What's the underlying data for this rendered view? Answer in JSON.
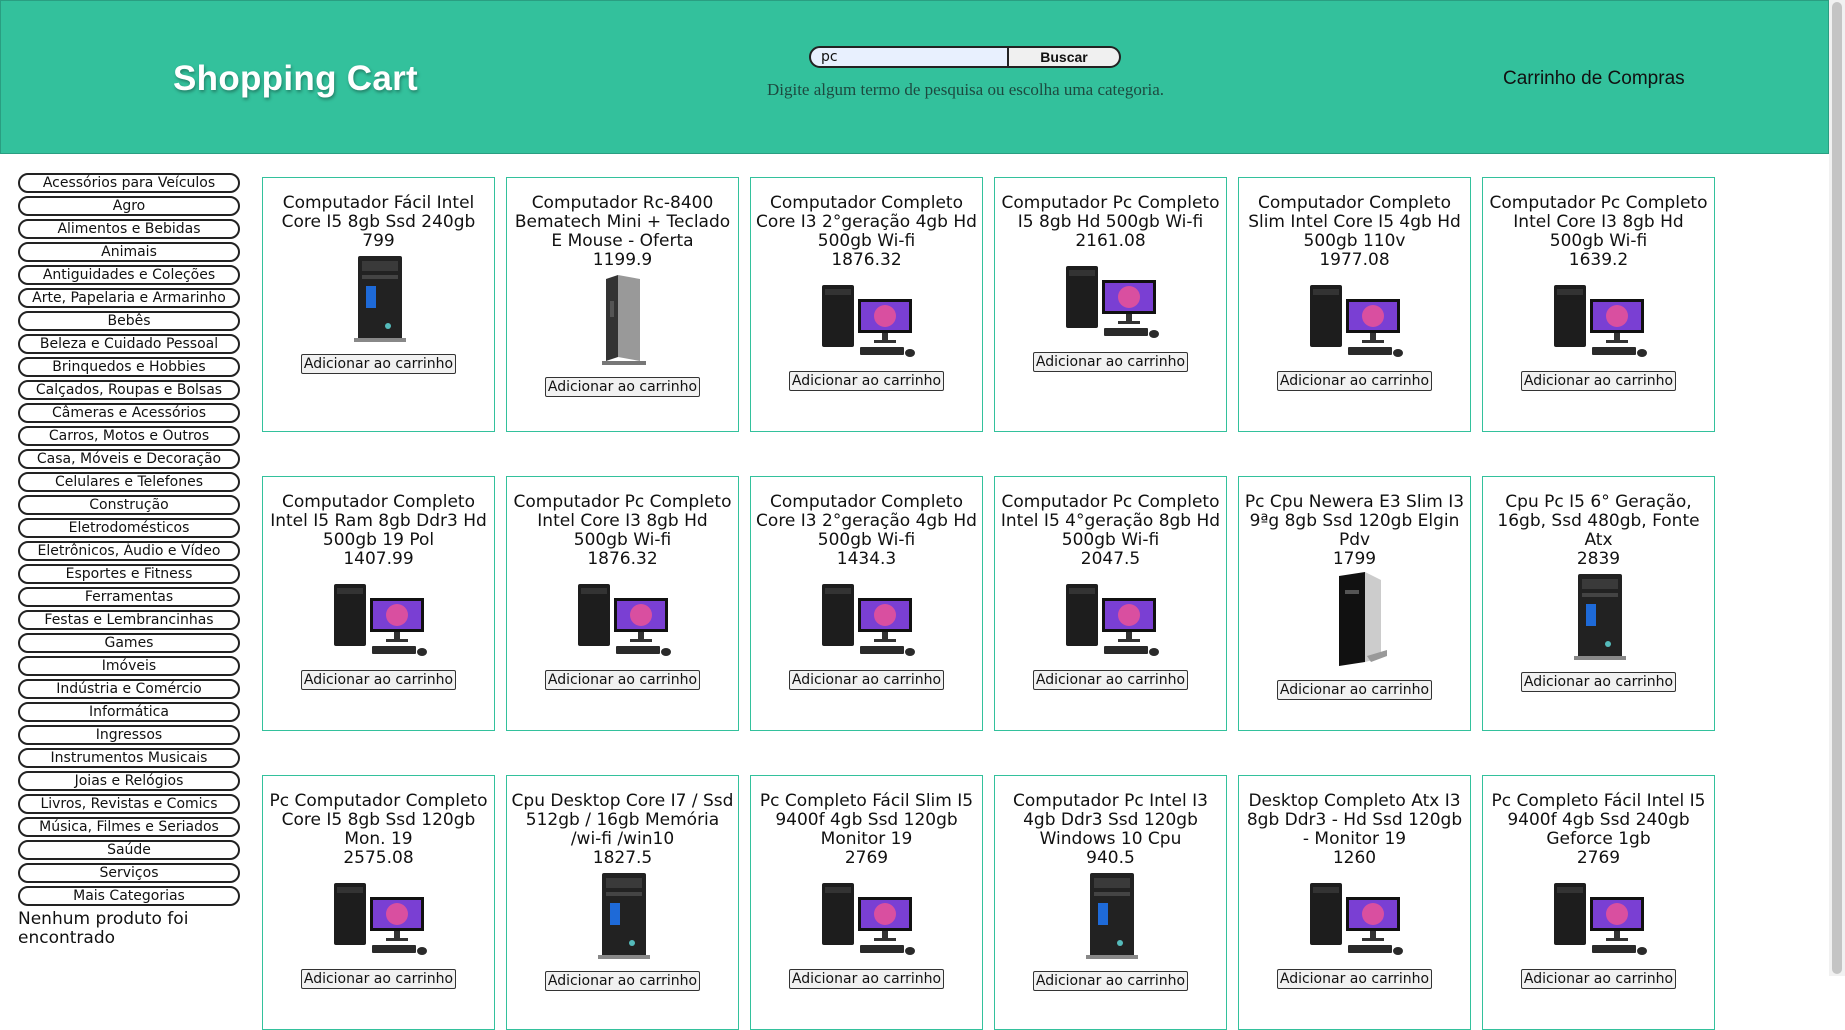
{
  "header": {
    "brand": "Shopping Cart",
    "search_value": "pc",
    "search_button": "Buscar",
    "hint": "Digite algum termo de pesquisa ou escolha uma categoria.",
    "cart_link": "Carrinho de Compras"
  },
  "sidebar": {
    "categories": [
      "Acessórios para Veículos",
      "Agro",
      "Alimentos e Bebidas",
      "Animais",
      "Antiguidades e Coleções",
      "Arte, Papelaria e Armarinho",
      "Bebês",
      "Beleza e Cuidado Pessoal",
      "Brinquedos e Hobbies",
      "Calçados, Roupas e Bolsas",
      "Câmeras e Acessórios",
      "Carros, Motos e Outros",
      "Casa, Móveis e Decoração",
      "Celulares e Telefones",
      "Construção",
      "Eletrodomésticos",
      "Eletrônicos, Áudio e Vídeo",
      "Esportes e Fitness",
      "Ferramentas",
      "Festas e Lembrancinhas",
      "Games",
      "Imóveis",
      "Indústria e Comércio",
      "Informática",
      "Ingressos",
      "Instrumentos Musicais",
      "Joias e Relógios",
      "Livros, Revistas e Comics",
      "Música, Filmes e Seriados",
      "Saúde",
      "Serviços",
      "Mais Categorias"
    ],
    "not_found": "Nenhum produto foi encontrado"
  },
  "add_label": "Adicionar ao carrinho",
  "colors": {
    "accent": "#33c19c"
  },
  "products": [
    {
      "title": "Computador Fácil Intel Core I5 8gb Ssd 240gb",
      "price": "799",
      "image": "tower-icon"
    },
    {
      "title": "Computador Rc-8400 Bematech Mini + Teclado E Mouse - Oferta",
      "price": "1199.9",
      "image": "mini-pc-icon"
    },
    {
      "title": "Computador Completo Core I3 2°geração 4gb Hd 500gb Wi-fi",
      "price": "1876.32",
      "image": "desktop-set-icon"
    },
    {
      "title": "Computador Pc Completo I5 8gb Hd 500gb Wi-fi",
      "price": "2161.08",
      "image": "desktop-set-icon"
    },
    {
      "title": "Computador Completo Slim Intel Core I5 4gb Hd 500gb 110v",
      "price": "1977.08",
      "image": "desktop-set-icon"
    },
    {
      "title": "Computador Pc Completo Intel Core I3 8gb Hd 500gb Wi-fi",
      "price": "1639.2",
      "image": "desktop-set-icon"
    },
    {
      "title": "Computador Completo Intel I5 Ram 8gb Ddr3 Hd 500gb 19 Pol",
      "price": "1407.99",
      "image": "desktop-set-icon"
    },
    {
      "title": "Computador Pc Completo Intel Core I3 8gb Hd 500gb Wi-fi",
      "price": "1876.32",
      "image": "desktop-set-icon"
    },
    {
      "title": "Computador Completo Core I3 2°geração 4gb Hd 500gb Wi-fi",
      "price": "1434.3",
      "image": "desktop-set-icon"
    },
    {
      "title": "Computador Pc Completo Intel I5 4°geração 8gb Hd 500gb Wi-fi",
      "price": "2047.5",
      "image": "desktop-set-icon"
    },
    {
      "title": "Pc Cpu Newera E3 Slim I3 9ªg 8gb Ssd 120gb Elgin Pdv",
      "price": "1799",
      "image": "slim-tower-icon"
    },
    {
      "title": "Cpu Pc I5 6° Geração, 16gb, Ssd 480gb, Fonte Atx",
      "price": "2839",
      "image": "tower-icon"
    },
    {
      "title": "Pc Computador Completo Core I5 8gb Ssd 120gb Mon. 19",
      "price": "2575.08",
      "image": "desktop-set-icon"
    },
    {
      "title": "Cpu Desktop Core I7 / Ssd 512gb / 16gb Memória /wi-fi /win10",
      "price": "1827.5",
      "image": "tower-icon"
    },
    {
      "title": "Pc Completo Fácil Slim I5 9400f 4gb Ssd 120gb Monitor 19",
      "price": "2769",
      "image": "desktop-set-icon"
    },
    {
      "title": "Computador Pc Intel I3 4gb Ddr3 Ssd 120gb Windows 10 Cpu",
      "price": "940.5",
      "image": "tower-icon"
    },
    {
      "title": "Desktop Completo Atx I3 8gb Ddr3 - Hd Ssd 120gb - Monitor 19",
      "price": "1260",
      "image": "desktop-set-icon"
    },
    {
      "title": "Pc Completo Fácil Intel I5 9400f 4gb Ssd 240gb Geforce 1gb",
      "price": "2769",
      "image": "desktop-set-icon"
    }
  ]
}
